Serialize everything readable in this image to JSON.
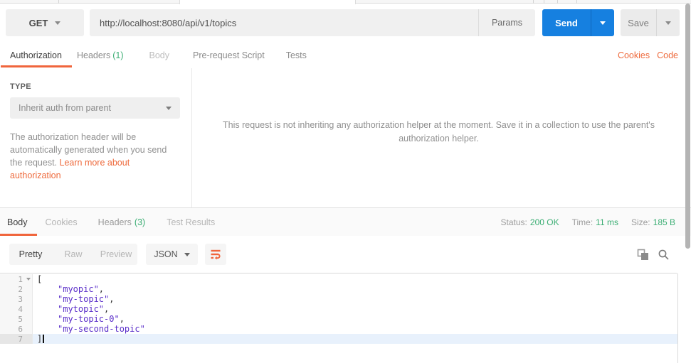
{
  "colors": {
    "accent_orange": "#F0653C",
    "send_blue": "#1680E0",
    "success_green": "#3CAE74",
    "json_string_purple": "#5A2EC9"
  },
  "request": {
    "method": "GET",
    "url": "http://localhost:8080/api/v1/topics",
    "params": "Params",
    "send": "Send",
    "save": "Save"
  },
  "request_tabs": {
    "authorization": "Authorization",
    "headers": "Headers",
    "headers_badge": "(1)",
    "body": "Body",
    "prerequest": "Pre-request Script",
    "tests": "Tests",
    "cookies": "Cookies",
    "code": "Code"
  },
  "auth": {
    "type_label": "TYPE",
    "type_value": "Inherit auth from parent",
    "description": "The authorization header will be automatically generated when you send the request. ",
    "link": "Learn more about authorization",
    "message": "This request is not inheriting any authorization helper at the moment. Save it in a collection to use the parent's authorization helper."
  },
  "response": {
    "tabs": {
      "body": "Body",
      "cookies": "Cookies",
      "headers": "Headers",
      "headers_badge": "(3)",
      "tests": "Test Results"
    },
    "status": {
      "label": "Status:",
      "value": "200 OK"
    },
    "time": {
      "label": "Time:",
      "value": "11 ms"
    },
    "size": {
      "label": "Size:",
      "value": "185 B"
    },
    "views": {
      "pretty": "Pretty",
      "raw": "Raw",
      "preview": "Preview"
    },
    "format": "JSON"
  },
  "editor": {
    "lines": [
      {
        "num": "1",
        "str": "",
        "punct": "["
      },
      {
        "num": "2",
        "str": "\"myopic\"",
        "punct": ","
      },
      {
        "num": "3",
        "str": "\"my-topic\"",
        "punct": ","
      },
      {
        "num": "4",
        "str": "\"mytopic\"",
        "punct": ","
      },
      {
        "num": "5",
        "str": "\"my-topic-0\"",
        "punct": ","
      },
      {
        "num": "6",
        "str": "\"my-second-topic\"",
        "punct": ""
      },
      {
        "num": "7",
        "str": "",
        "punct": "]"
      }
    ]
  }
}
